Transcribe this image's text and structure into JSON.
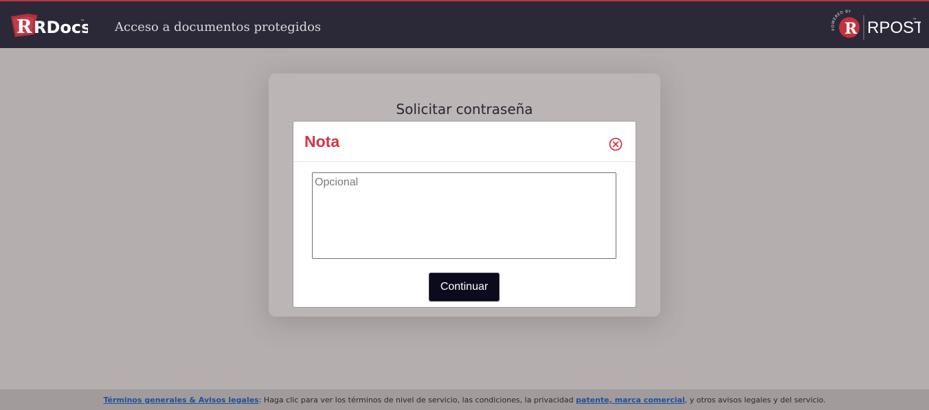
{
  "header": {
    "logo_text": "RDocs",
    "logo_tm": "™",
    "title": "Acceso a documentos protegidos",
    "powered_by_text": "POWERED BY",
    "powered_brand": "RPOST",
    "powered_tm": "™"
  },
  "card": {
    "title": "Solicitar contraseña"
  },
  "modal": {
    "title": "Nota",
    "note_placeholder": "Opcional",
    "note_value": "",
    "continue_label": "Continuar"
  },
  "footer": {
    "terms_link": "Términos generales & Avisos legales",
    "text_1": ": Haga clic para ver los términos de nivel de servicio, las condiciones, la privacidad ",
    "patent_link": "patente, marca comercial",
    "text_2": ", y otros avisos legales y del servicio."
  },
  "colors": {
    "header_bg": "#2b2838",
    "header_accent": "#c0333d",
    "page_bg": "#b5aeae",
    "modal_title": "#d43545",
    "button_bg": "#0c0b1e",
    "link": "#1f4f9c"
  },
  "icons": {
    "logo": "rdocs-logo",
    "powered": "rpost-logo",
    "close": "close-circle-icon"
  }
}
